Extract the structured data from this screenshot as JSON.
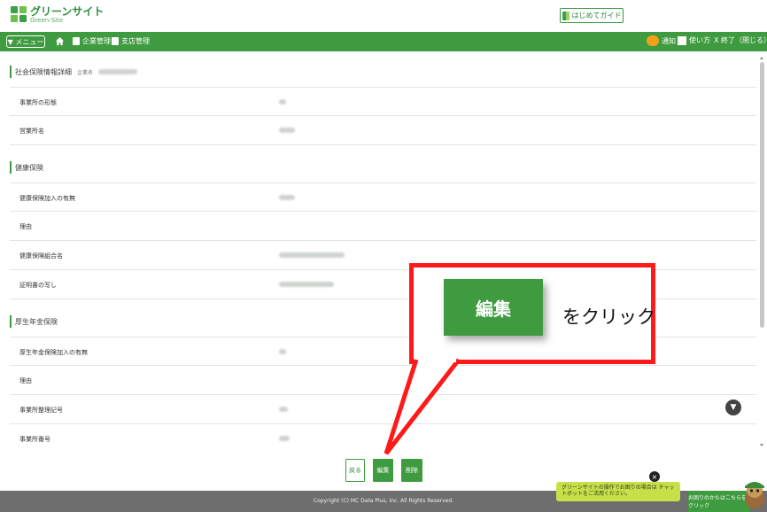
{
  "header": {
    "logo_jp": "グリーンサイト",
    "logo_en": "Green-Site",
    "guide_label": "はじめてガイド"
  },
  "nav": {
    "menu_label": "▼ メニュー",
    "links": [
      "企業管理",
      "支店管理"
    ],
    "notify_label": "通知",
    "howto_label": "使い方",
    "exit_label": "X 終了（閉じる）"
  },
  "page": {
    "title": "社会保険情報詳細",
    "company_caption": "企業名",
    "rows_top": [
      {
        "label": "事業所の形態"
      },
      {
        "label": "営業所名"
      }
    ],
    "section_health": "健康保険",
    "rows_health": [
      {
        "label": "健康保険加入の有無"
      },
      {
        "label": "理由"
      },
      {
        "label": "健康保険組合名"
      },
      {
        "label": "証明書の写し"
      }
    ],
    "section_pension": "厚生年金保険",
    "rows_pension": [
      {
        "label": "厚生年金保険加入の有無"
      },
      {
        "label": "理由"
      },
      {
        "label": "事業所整理記号"
      },
      {
        "label": "事業所番号"
      }
    ]
  },
  "buttons": {
    "back": "戻る",
    "edit": "編集",
    "delete": "削除"
  },
  "footer": {
    "copyright": "Copyright (C) MC Data Plus, Inc. All Rights Reserved.",
    "chat_bubble": "グリーンサイトの操作でお困りの場合は チャットボットをご活用ください。",
    "chat_cta": "お困りのかたはこちらをクリック"
  },
  "callout": {
    "button_label": "編集",
    "instruction": "をクリック"
  },
  "colors": {
    "brand_green": "#3f9b3f",
    "callout_red": "#ff1a1a"
  }
}
